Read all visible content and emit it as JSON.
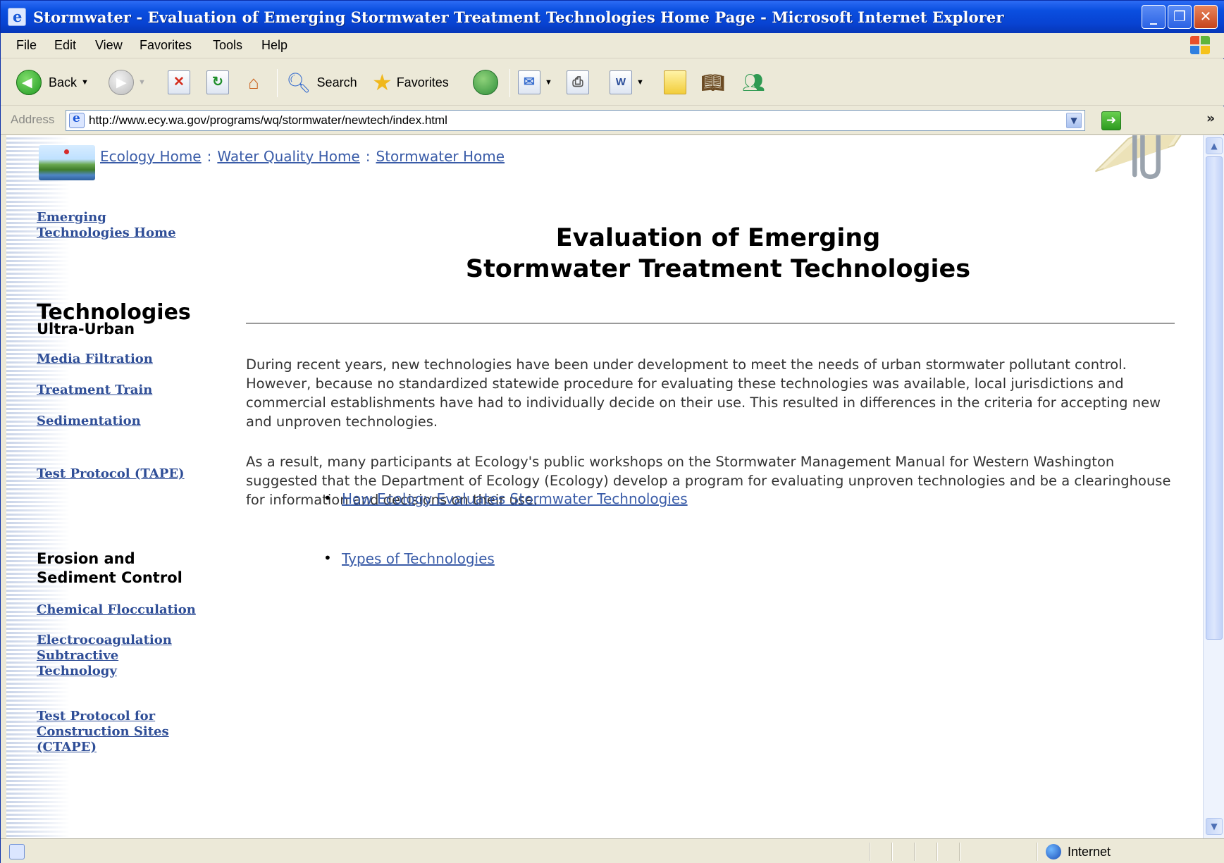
{
  "window": {
    "title": "Stormwater - Evaluation of Emerging Stormwater Treatment Technologies Home Page - Microsoft Internet Explorer"
  },
  "menu": [
    "File",
    "Edit",
    "View",
    "Favorites",
    "Tools",
    "Help"
  ],
  "toolbar": {
    "back_label": "Back",
    "search_label": "Search",
    "favorites_label": "Favorites"
  },
  "address": {
    "label": "Address",
    "url": "http://www.ecy.wa.gov/programs/wq/stormwater/newtech/index.html"
  },
  "breadcrumb": {
    "items": [
      "Ecology Home",
      "Water Quality Home",
      "Stormwater Home"
    ],
    "separator": ":"
  },
  "sidebar": {
    "home_link": [
      "Emerging",
      "Technologies Home"
    ],
    "heading": "Technologies",
    "ultra_urban": {
      "heading": "Ultra-Urban",
      "links": [
        "Media Filtration",
        "Treatment Train",
        "Sedimentation"
      ],
      "protocol": "Test Protocol (TAPE)"
    },
    "erosion": {
      "heading": [
        "Erosion and",
        "Sediment Control"
      ],
      "links": [
        "Chemical Flocculation"
      ],
      "electro": [
        "Electrocoagulation",
        "Subtractive",
        "Technology"
      ],
      "protocol": [
        "Test Protocol for",
        "Construction Sites",
        "(CTAPE)"
      ]
    }
  },
  "main": {
    "title_line1": "Evaluation of Emerging",
    "title_line2": "Stormwater Treatment Technologies",
    "para1": "During recent years, new technologies have been under development to meet the needs of urban stormwater pollutant control. However, because no standardized statewide procedure for evaluating these technologies was available, local jurisdictions and commercial establishments have had to individually decide on their use. This resulted in differences in the criteria for accepting new and unproven technologies.",
    "para2": "As a result, many participants at Ecology's public workshops on the Stormwater Management Manual for Western Washington suggested that the Department of Ecology (Ecology) develop a program for evaluating unproven technologies and be a clearinghouse for information and decisions on their use.",
    "links": [
      "How Ecology Evaluates Stormwater Technologies",
      "Types of Technologies"
    ]
  },
  "status": {
    "zone": "Internet"
  }
}
